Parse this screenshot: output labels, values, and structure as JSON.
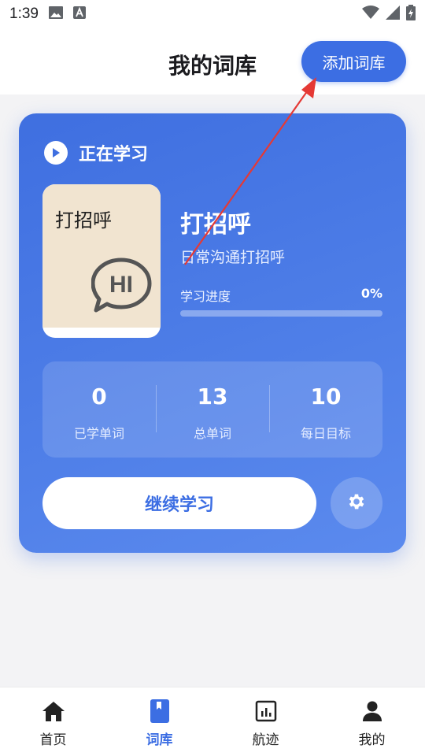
{
  "status_bar": {
    "time": "1:39",
    "icons": [
      "image-icon",
      "text-a-icon",
      "wifi-icon",
      "signal-icon",
      "battery-icon"
    ]
  },
  "header": {
    "title": "我的词库",
    "add_button_label": "添加词库"
  },
  "study_card": {
    "section_title": "正在学习",
    "cover_title": "打招呼",
    "cover_badge": "HI",
    "book_name": "打招呼",
    "book_desc": "日常沟通打招呼",
    "progress_label": "学习进度",
    "progress_value": "0%",
    "progress_fraction": 0,
    "stats": [
      {
        "value": "0",
        "label": "已学单词"
      },
      {
        "value": "13",
        "label": "总单词"
      },
      {
        "value": "10",
        "label": "每日目标"
      }
    ],
    "continue_label": "继续学习"
  },
  "bottom_nav": {
    "items": [
      {
        "label": "首页",
        "icon": "home-icon",
        "active": false
      },
      {
        "label": "词库",
        "icon": "book-icon",
        "active": true
      },
      {
        "label": "航迹",
        "icon": "chart-icon",
        "active": false
      },
      {
        "label": "我的",
        "icon": "person-icon",
        "active": false
      }
    ]
  },
  "colors": {
    "accent": "#3c6ee3",
    "annotation": "#e53935"
  }
}
